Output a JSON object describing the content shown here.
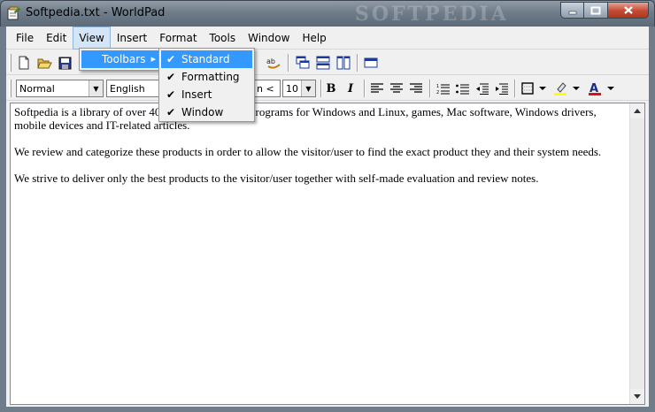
{
  "window": {
    "title": "Softpedia.txt - WorldPad",
    "watermark": "SOFTPEDIA",
    "minimize": "0",
    "maximize": "1",
    "close": "r"
  },
  "menubar": {
    "items": [
      {
        "label": "File",
        "underline": "F"
      },
      {
        "label": "Edit",
        "underline": "E"
      },
      {
        "label": "View",
        "underline": "V",
        "active": true
      },
      {
        "label": "Insert",
        "underline": "I"
      },
      {
        "label": "Format",
        "underline": "o"
      },
      {
        "label": "Tools",
        "underline": "T"
      },
      {
        "label": "Window",
        "underline": "W"
      },
      {
        "label": "Help",
        "underline": "H"
      }
    ]
  },
  "view_menu": {
    "items": [
      {
        "label": "Toolbars",
        "highlighted": true,
        "has_submenu": true
      }
    ]
  },
  "toolbars_menu": {
    "items": [
      {
        "label": "Standard",
        "checked": true,
        "highlighted": true
      },
      {
        "label": "Formatting",
        "checked": true
      },
      {
        "label": "Insert",
        "checked": true
      },
      {
        "label": "Window",
        "checked": true
      }
    ]
  },
  "formatting": {
    "style": "Normal",
    "language": "English",
    "font_partial": "n <",
    "size": "10",
    "bold": "B",
    "italic": "I"
  },
  "document": {
    "paragraphs": [
      "Softpedia is a library of over 40… -to-try software programs for Windows and Linux, games, Mac software, Windows drivers, mobile devices and IT-related articles.",
      "We review and categorize these products in order to allow the visitor/user to find the exact product they and their system needs.",
      "We strive to deliver only the best products to the visitor/user together with self-made evaluation and review notes."
    ]
  },
  "colors": {
    "highlight": "#3399ff",
    "menu_active": "#d3e5f6",
    "font_color": "#e01010",
    "highlight_color": "#ffff00"
  }
}
